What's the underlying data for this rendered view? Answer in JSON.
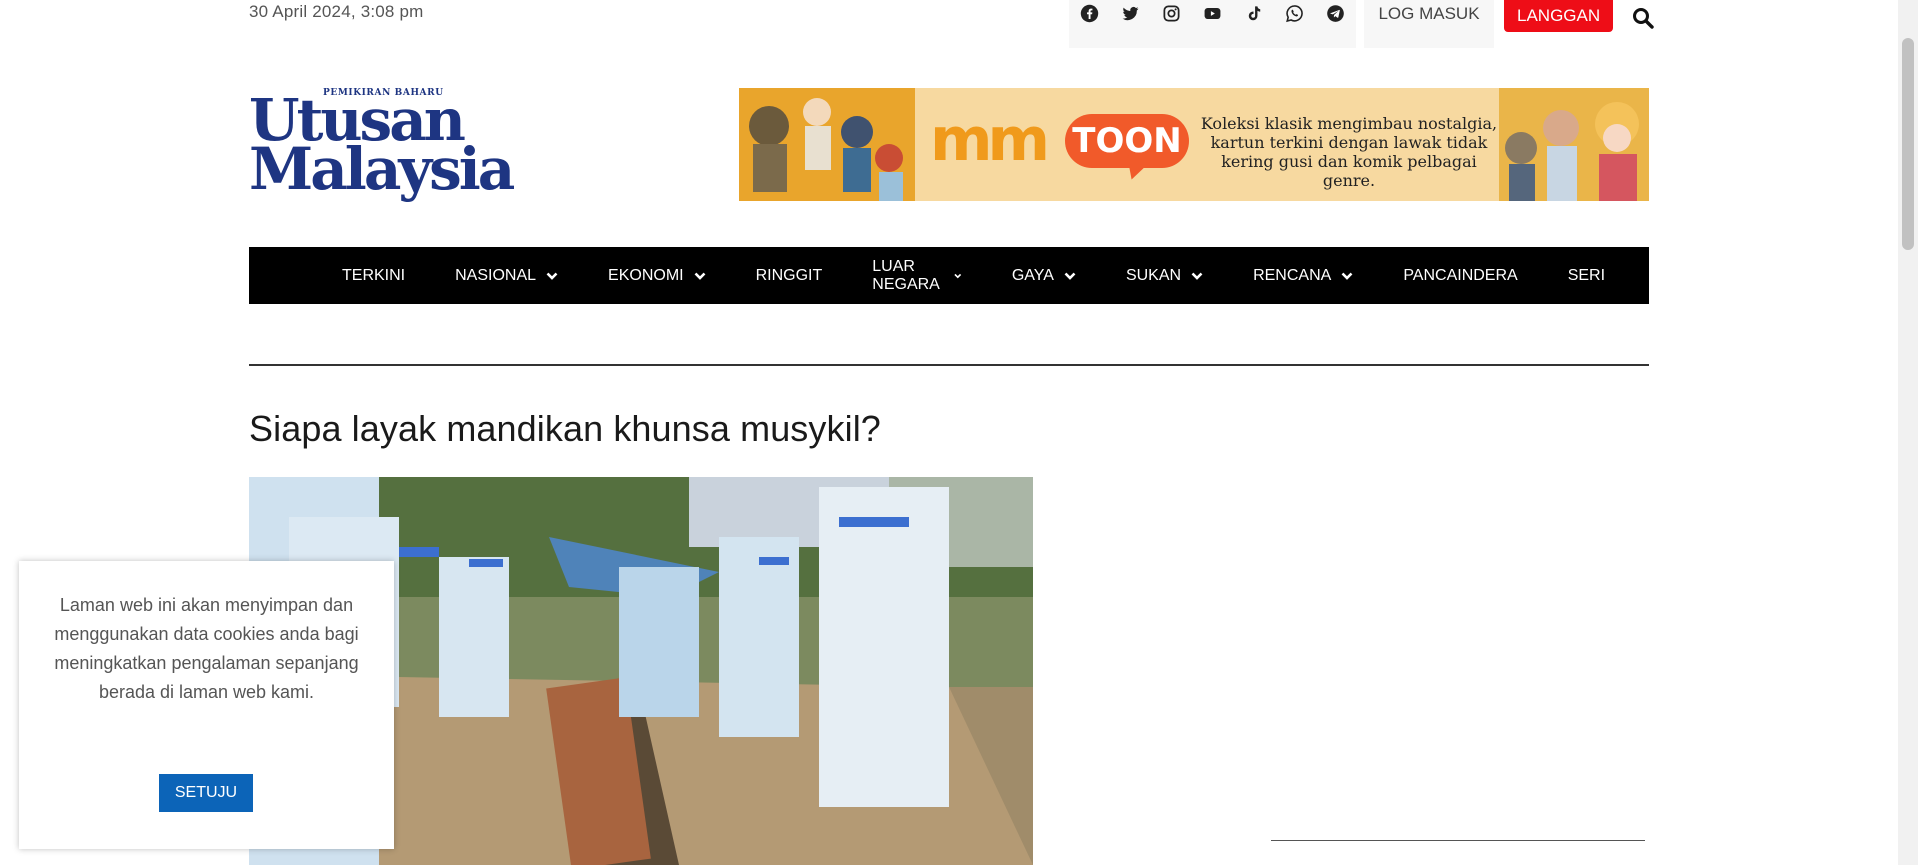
{
  "header": {
    "date": "30 April 2024, 3:08 pm",
    "social_icons": [
      "facebook-icon",
      "twitter-icon",
      "instagram-icon",
      "youtube-icon",
      "tiktok-icon",
      "whatsapp-icon",
      "telegram-icon"
    ],
    "login_label": "LOG MASUK",
    "subscribe_label": "LANGGAN",
    "subscribe_color": "#ee0d17"
  },
  "logo": {
    "tagline": "PEMIKIRAN BAHARU",
    "line1": "Utusan",
    "line2": "Malaysia",
    "color": "#1e3582"
  },
  "banner": {
    "brand_mm": "mm",
    "brand_toon": "TOON",
    "text": "Koleksi klasik mengimbau nostalgia, kartun terkini dengan lawak tidak kering gusi dan komik pelbagai genre."
  },
  "nav": {
    "items": [
      {
        "label": "TERKINI",
        "dropdown": false
      },
      {
        "label": "NASIONAL",
        "dropdown": true
      },
      {
        "label": "EKONOMI",
        "dropdown": true
      },
      {
        "label": "RINGGIT",
        "dropdown": false
      },
      {
        "label": "LUAR NEGARA",
        "dropdown": true
      },
      {
        "label": "GAYA",
        "dropdown": true
      },
      {
        "label": "SUKAN",
        "dropdown": true
      },
      {
        "label": "RENCANA",
        "dropdown": true
      },
      {
        "label": "PANCAINDERA",
        "dropdown": false
      },
      {
        "label": "SERI",
        "dropdown": false
      }
    ]
  },
  "article": {
    "title": "Siapa layak mandikan khunsa musykil?"
  },
  "cookie": {
    "message": "Laman web ini akan menyimpan dan menggunakan data cookies anda bagi meningkatkan pengalaman sepanjang berada di laman web kami.",
    "accept_label": "SETUJU",
    "accept_color": "#0c64b8"
  }
}
